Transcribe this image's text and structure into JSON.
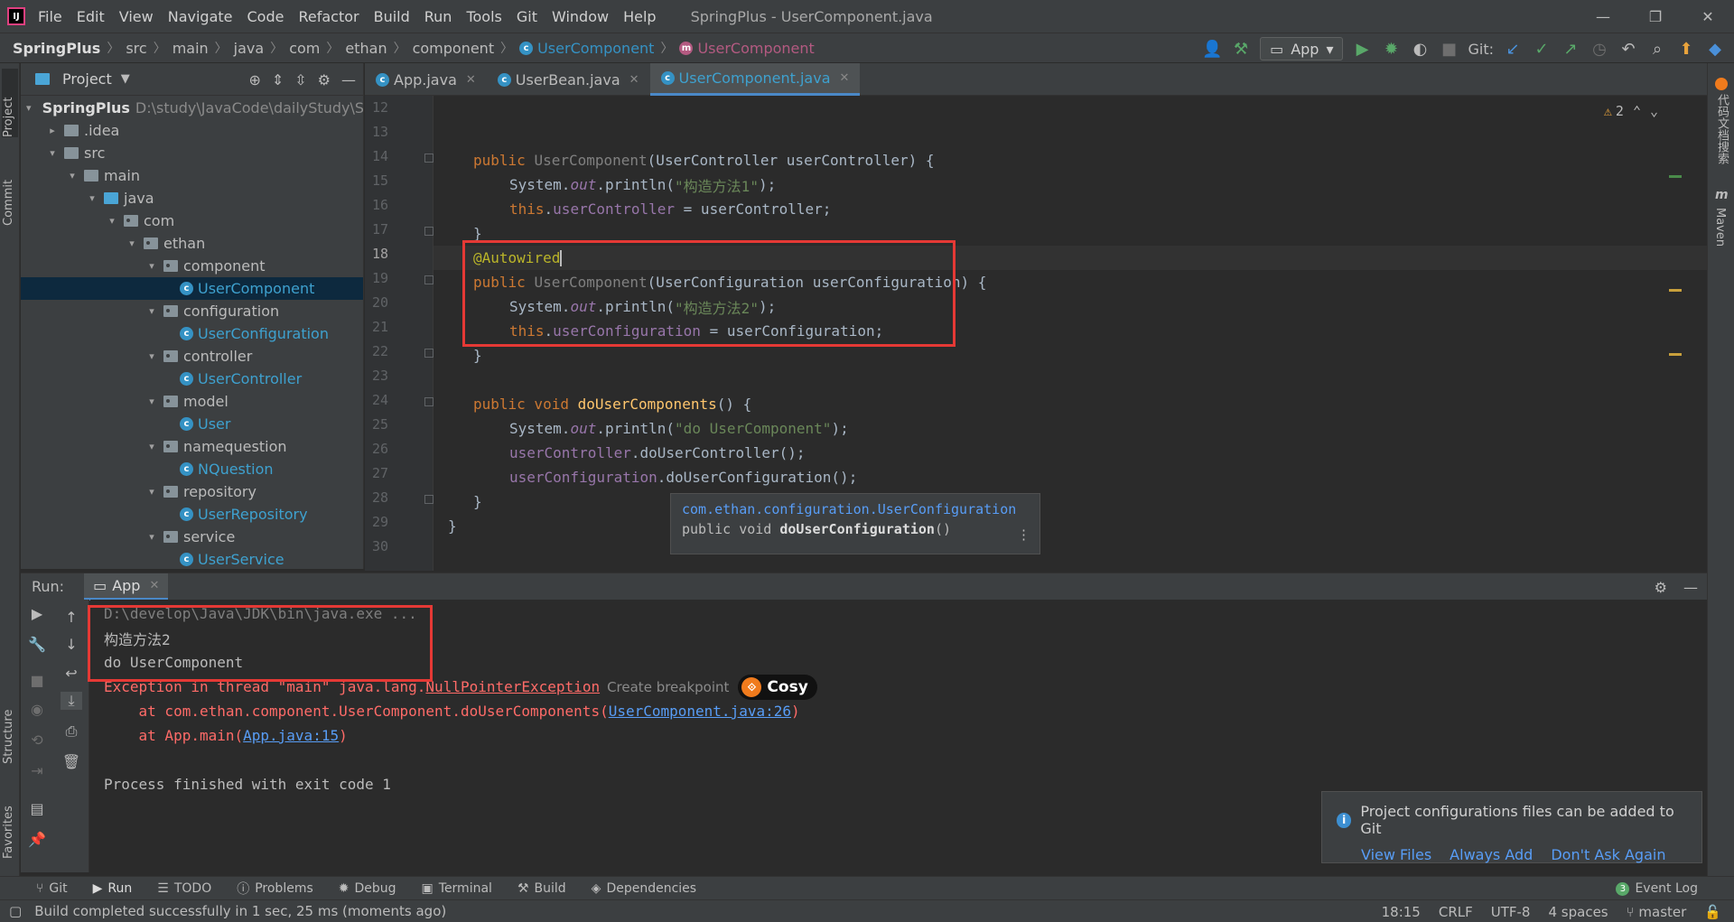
{
  "menubar": {
    "items": [
      "File",
      "Edit",
      "View",
      "Navigate",
      "Code",
      "Refactor",
      "Build",
      "Run",
      "Tools",
      "Git",
      "Window",
      "Help"
    ],
    "window_title": "SpringPlus - UserComponent.java"
  },
  "breadcrumbs": [
    "SpringPlus",
    "src",
    "main",
    "java",
    "com",
    "ethan",
    "component",
    "UserComponent",
    "UserComponent"
  ],
  "toolbar": {
    "run_config": "App",
    "git_label": "Git:"
  },
  "left_stripe": [
    "Project",
    "Commit",
    "Structure",
    "Favorites"
  ],
  "right_stripe": [
    "代码文档搜索",
    "Maven"
  ],
  "project": {
    "title": "Project",
    "root_name": "SpringPlus",
    "root_path": "D:\\study\\JavaCode\\dailyStudy\\S",
    "tree": [
      ".idea",
      "src",
      "main",
      "java",
      "com",
      "ethan",
      "component",
      "UserComponent",
      "configuration",
      "UserConfiguration",
      "controller",
      "UserController",
      "model",
      "User",
      "namequestion",
      "NQuestion",
      "repository",
      "UserRepository",
      "service",
      "UserService"
    ]
  },
  "tabs": [
    "App.java",
    "UserBean.java",
    "UserComponent.java"
  ],
  "editor": {
    "line_numbers": [
      "12",
      "13",
      "14",
      "15",
      "16",
      "17",
      "18",
      "19",
      "20",
      "21",
      "22",
      "23",
      "24",
      "25",
      "26",
      "27",
      "28",
      "29",
      "30"
    ],
    "c14": {
      "kw": "public ",
      "ctor": "UserComponent",
      "rest": "(UserController userController) {"
    },
    "c15": {
      "a": "System.",
      "b": "out",
      "c": ".println(",
      "s": "\"构造方法1\"",
      "d": ");"
    },
    "c16": {
      "a": "this",
      "b": ".",
      "f": "userController",
      "c": " = userController;"
    },
    "c17": "}",
    "c18": "@Autowired",
    "c19": {
      "kw": "public ",
      "ctor": "UserComponent",
      "rest": "(UserConfiguration userConfiguration) {"
    },
    "c20": {
      "a": "System.",
      "b": "out",
      "c": ".println(",
      "s": "\"构造方法2\"",
      "d": ");"
    },
    "c21": {
      "a": "this",
      "b": ".",
      "f": "userConfiguration",
      "c": " = userConfiguration;"
    },
    "c22": "}",
    "c24": {
      "kw": "public void ",
      "fn": "doUserComponents",
      "rest": "() {"
    },
    "c25": {
      "a": "System.",
      "b": "out",
      "c": ".println(",
      "s": "\"do UserComponent\"",
      "d": ");"
    },
    "c26": {
      "f": "userController",
      "c": ".doUserController();"
    },
    "c27": {
      "f": "userConfiguration",
      "c": ".doUserConfiguration();"
    },
    "c28": "}",
    "c29": "}",
    "inspection_count": "2"
  },
  "hint": {
    "line1": "com.ethan.configuration.UserConfiguration",
    "line2_prefix": "public void ",
    "line2_method": "doUserConfiguration",
    "line2_suffix": "()"
  },
  "run": {
    "label": "Run:",
    "tab": "App",
    "console": {
      "l1": "D:\\develop\\Java\\JDK\\bin\\java.exe ...",
      "l2": "构造方法2",
      "l3": "do UserComponent",
      "l4_prefix": "Exception in thread \"main\" java.lang.",
      "l4_exc": "NullPointerException",
      "bp_hint": "Create breakpoint",
      "cosy": "Cosy",
      "l5_prefix": "    at com.ethan.component.UserComponent.doUserComponents(",
      "l5_link": "UserComponent.java:26",
      "l5_suffix": ")",
      "l6_prefix": "    at App.main(",
      "l6_link": "App.java:15",
      "l6_suffix": ")",
      "l8": "Process finished with exit code 1"
    }
  },
  "notification": {
    "message": "Project configurations files can be added to Git",
    "actions": [
      "View Files",
      "Always Add",
      "Don't Ask Again"
    ]
  },
  "toolwindows": [
    "Git",
    "Run",
    "TODO",
    "Problems",
    "Debug",
    "Terminal",
    "Build",
    "Dependencies"
  ],
  "event_log": {
    "label": "Event Log",
    "count": "3"
  },
  "status": {
    "message": "Build completed successfully in 1 sec, 25 ms (moments ago)",
    "position": "18:15",
    "line_sep": "CRLF",
    "encoding": "UTF-8",
    "indent": "4 spaces",
    "branch": "master"
  },
  "colors": {
    "accent": "#4a88c7",
    "highlight_box": "#e53935",
    "keyword": "#cc7832",
    "string": "#6a8759",
    "field": "#9876aa"
  }
}
